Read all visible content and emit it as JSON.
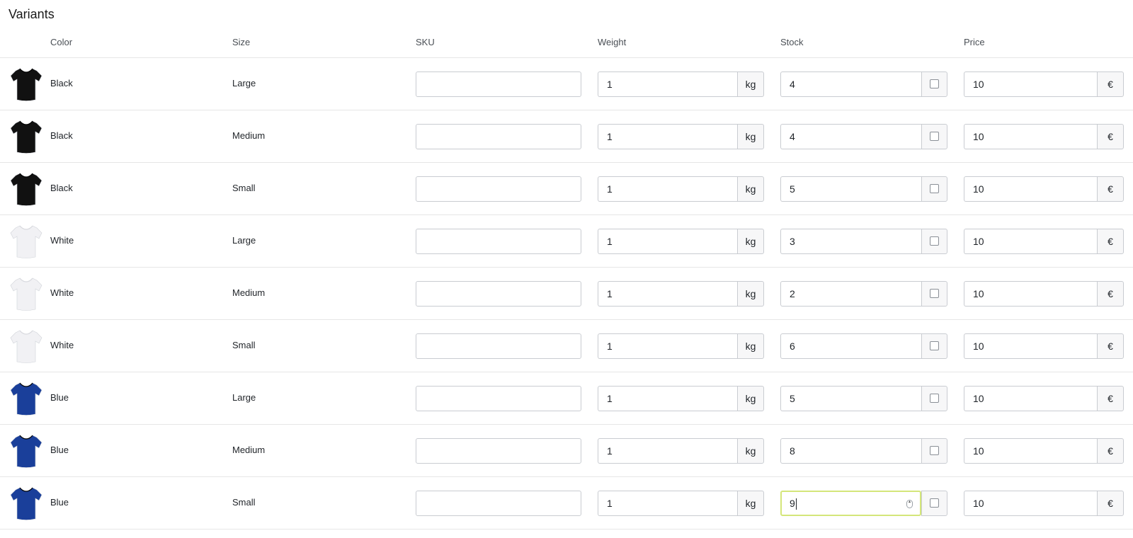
{
  "section": {
    "title": "Variants"
  },
  "columns": {
    "color": "Color",
    "size": "Size",
    "sku": "SKU",
    "weight": "Weight",
    "stock": "Stock",
    "price": "Price"
  },
  "units": {
    "weight": "kg",
    "currency": "€"
  },
  "colors": {
    "Black": "#111111",
    "White": "#f1f1f4",
    "Blue": "#1a3f9a",
    "focus_ring": "#d4e67a"
  },
  "rows": [
    {
      "color": "Black",
      "size": "Large",
      "sku": "",
      "weight": "1",
      "stock": "4",
      "price": "10",
      "icon": "black-tshirt-icon",
      "focused": false
    },
    {
      "color": "Black",
      "size": "Medium",
      "sku": "",
      "weight": "1",
      "stock": "4",
      "price": "10",
      "icon": "black-tshirt-icon",
      "focused": false
    },
    {
      "color": "Black",
      "size": "Small",
      "sku": "",
      "weight": "1",
      "stock": "5",
      "price": "10",
      "icon": "black-tshirt-icon",
      "focused": false
    },
    {
      "color": "White",
      "size": "Large",
      "sku": "",
      "weight": "1",
      "stock": "3",
      "price": "10",
      "icon": "white-tshirt-icon",
      "focused": false
    },
    {
      "color": "White",
      "size": "Medium",
      "sku": "",
      "weight": "1",
      "stock": "2",
      "price": "10",
      "icon": "white-tshirt-icon",
      "focused": false
    },
    {
      "color": "White",
      "size": "Small",
      "sku": "",
      "weight": "1",
      "stock": "6",
      "price": "10",
      "icon": "white-tshirt-icon",
      "focused": false
    },
    {
      "color": "Blue",
      "size": "Large",
      "sku": "",
      "weight": "1",
      "stock": "5",
      "price": "10",
      "icon": "blue-tshirt-icon",
      "focused": false
    },
    {
      "color": "Blue",
      "size": "Medium",
      "sku": "",
      "weight": "1",
      "stock": "8",
      "price": "10",
      "icon": "blue-tshirt-icon",
      "focused": false
    },
    {
      "color": "Blue",
      "size": "Small",
      "sku": "",
      "weight": "1",
      "stock": "9",
      "price": "10",
      "icon": "blue-tshirt-icon",
      "focused": true
    }
  ]
}
